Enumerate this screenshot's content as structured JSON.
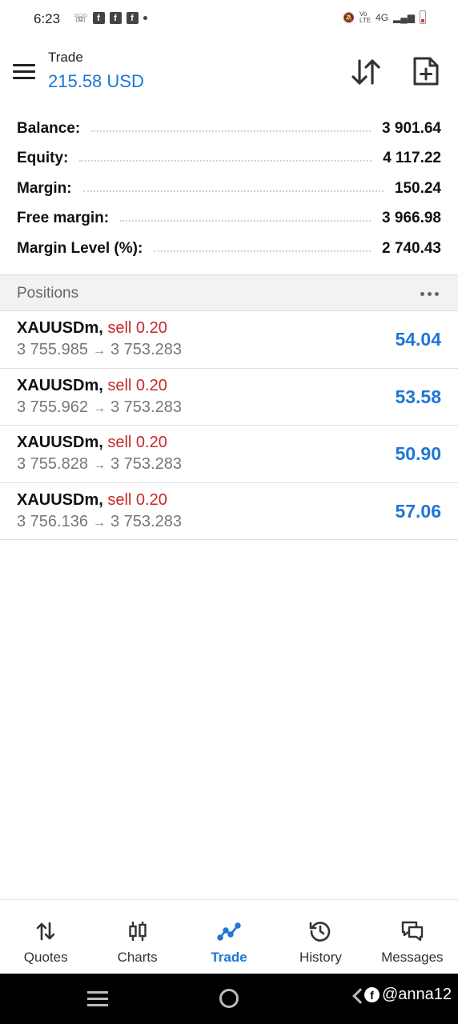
{
  "status_bar": {
    "time": "6:23",
    "left_icons": [
      "chat-icon",
      "facebook-icon",
      "facebook-icon",
      "facebook-icon",
      "dot-icon"
    ],
    "network": "4G",
    "volte": "Vo LTE",
    "right_icons": [
      "mute-icon",
      "signal-icon",
      "battery-icon"
    ]
  },
  "header": {
    "title": "Trade",
    "balance": "215.58 USD",
    "accent_color": "#1e76d6"
  },
  "summary": [
    {
      "label": "Balance:",
      "value": "3 901.64"
    },
    {
      "label": "Equity:",
      "value": "4 117.22"
    },
    {
      "label": "Margin:",
      "value": "150.24"
    },
    {
      "label": "Free margin:",
      "value": "3 966.98"
    },
    {
      "label": "Margin Level (%):",
      "value": "2 740.43"
    }
  ],
  "positions_header": {
    "title": "Positions"
  },
  "positions": [
    {
      "symbol": "XAUUSDm,",
      "side": "sell 0.20",
      "open_price": "3 755.985",
      "arrow": "→",
      "current_price": "3 753.283",
      "profit": "54.04"
    },
    {
      "symbol": "XAUUSDm,",
      "side": "sell 0.20",
      "open_price": "3 755.962",
      "arrow": "→",
      "current_price": "3 753.283",
      "profit": "53.58"
    },
    {
      "symbol": "XAUUSDm,",
      "side": "sell 0.20",
      "open_price": "3 755.828",
      "arrow": "→",
      "current_price": "3 753.283",
      "profit": "50.90"
    },
    {
      "symbol": "XAUUSDm,",
      "side": "sell 0.20",
      "open_price": "3 756.136",
      "arrow": "→",
      "current_price": "3 753.283",
      "profit": "57.06"
    }
  ],
  "bottom_nav": [
    {
      "label": "Quotes",
      "icon": "quotes-icon",
      "active": false
    },
    {
      "label": "Charts",
      "icon": "charts-icon",
      "active": false
    },
    {
      "label": "Trade",
      "icon": "trade-icon",
      "active": true
    },
    {
      "label": "History",
      "icon": "history-icon",
      "active": false
    },
    {
      "label": "Messages",
      "icon": "messages-icon",
      "active": false
    }
  ],
  "watermark": {
    "text": "@anna12"
  },
  "colors": {
    "profit": "#1e76d6",
    "sell": "#c62828",
    "text": "#111111",
    "muted": "#777777"
  }
}
